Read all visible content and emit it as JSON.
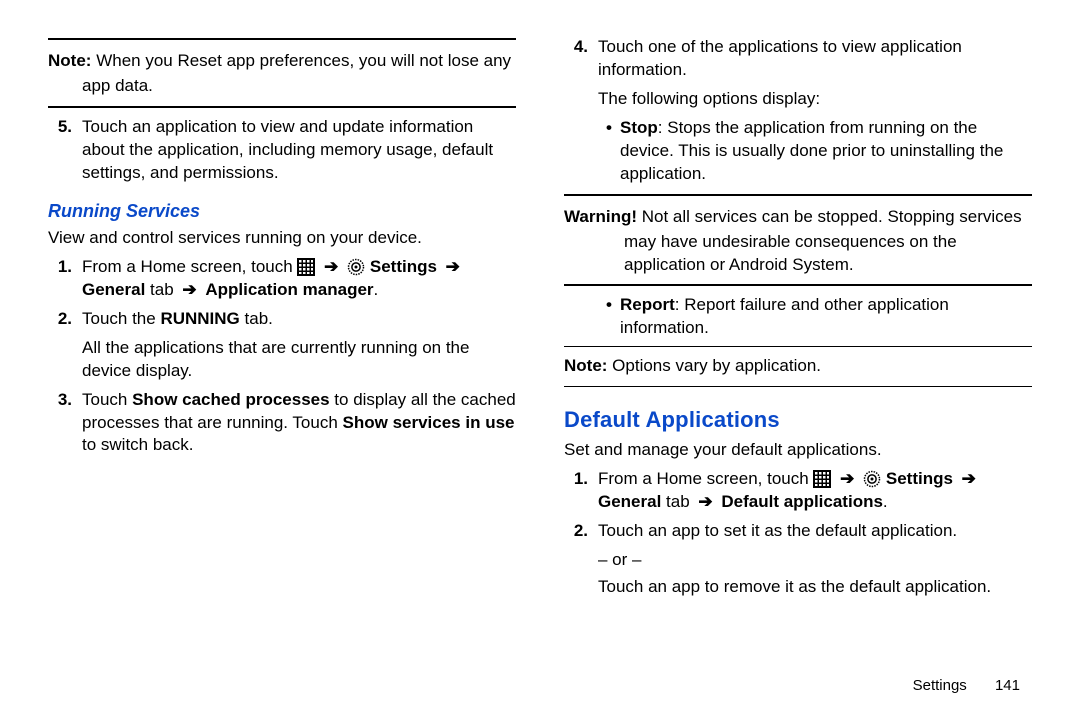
{
  "left": {
    "note1": {
      "label": "Note:",
      "body": "When you Reset app preferences, you will not lose any",
      "cont": "app data."
    },
    "step5": {
      "num": "5.",
      "text": "Touch an application to view and update information about the application, including memory usage, default settings, and permissions."
    },
    "runningHeading": "Running Services",
    "runningIntro": "View and control services running on your device.",
    "step1": {
      "num": "1.",
      "prefix": "From a Home screen, touch ",
      "settings": "Settings",
      "generalTab": "General",
      "tabWord": " tab ",
      "appMgr": "Application manager"
    },
    "step2": {
      "num": "2.",
      "prefix": "Touch the ",
      "running": "RUNNING",
      "suffix": " tab.",
      "cont": "All the applications that are currently running on the device display."
    },
    "step3": {
      "num": "3.",
      "t1": "Touch ",
      "b1": "Show cached processes",
      "t2": " to display all the cached processes that are running. Touch ",
      "b2": "Show services in use",
      "t3": " to switch back."
    }
  },
  "right": {
    "step4": {
      "num": "4.",
      "text": "Touch one of the applications to view application information.",
      "cont": "The following options display:"
    },
    "bulletStop": {
      "label": "Stop",
      "text": ": Stops the application from running on the device. This is usually done prior to uninstalling the application."
    },
    "warning": {
      "label": "Warning!",
      "t1": " Not all services can be stopped. Stopping services",
      "t2": "may have undesirable consequences on the",
      "t3": "application or Android System."
    },
    "bulletReport": {
      "label": "Report",
      "text": ": Report failure and other application information."
    },
    "note2": {
      "label": "Note:",
      "body": " Options vary by application."
    },
    "defaultHeading": "Default Applications",
    "defaultIntro": "Set and manage your default applications.",
    "dstep1": {
      "num": "1.",
      "prefix": "From a Home screen, touch ",
      "settings": "Settings",
      "generalTab": "General",
      "tabWord": " tab ",
      "defApps": "Default applications"
    },
    "dstep2": {
      "num": "2.",
      "text": "Touch an app to set it as the default application.",
      "or": "– or –",
      "cont": "Touch an app to remove it as the default application."
    }
  },
  "footer": {
    "section": "Settings",
    "page": "141"
  },
  "glyphs": {
    "arrow": "➔",
    "bullet": "•",
    "period": "."
  }
}
